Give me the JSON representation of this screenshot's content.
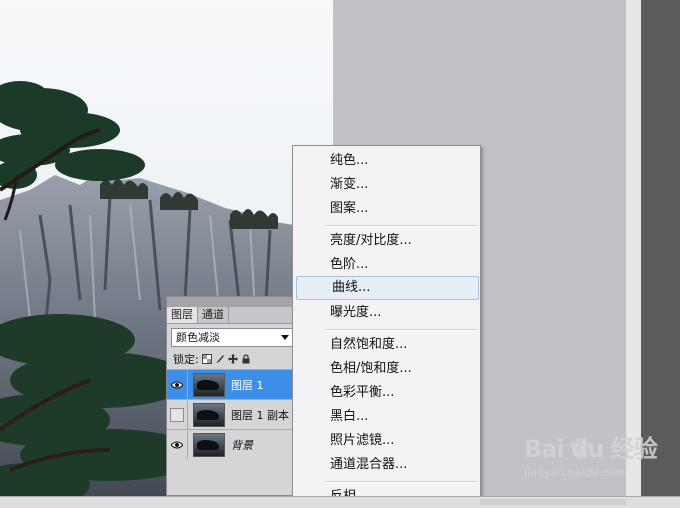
{
  "layers_panel": {
    "tabs": [
      "图层",
      "通道"
    ],
    "blend_mode": "颜色减淡",
    "lock_label": "锁定:",
    "layers": [
      {
        "name": "图层 1",
        "selected": true,
        "visible": true
      },
      {
        "name": "图层 1 副本",
        "selected": false,
        "visible": false
      },
      {
        "name": "背景",
        "selected": false,
        "visible": true
      }
    ]
  },
  "context_menu": {
    "groups": [
      [
        "纯色...",
        "渐变...",
        "图案..."
      ],
      [
        "亮度/对比度...",
        "色阶...",
        "曲线...",
        "曝光度..."
      ],
      [
        "自然饱和度...",
        "色相/饱和度...",
        "色彩平衡...",
        "黑白...",
        "照片滤镜...",
        "通道混合器..."
      ],
      [
        "反相"
      ]
    ],
    "highlighted": "曲线..."
  },
  "watermark": {
    "brand": "Bai du 经验",
    "url": "jingyan.baidu.com"
  },
  "colors": {
    "selection": "#3d8ee6",
    "menu_bg": "#f3f3f5",
    "workspace": "#c2c1c6"
  },
  "icons": [
    "eye-icon",
    "lock-transparent-icon",
    "lock-brush-icon",
    "lock-move-icon",
    "lock-all-icon",
    "layer-thumbnail",
    "dropdown-arrow-icon"
  ]
}
